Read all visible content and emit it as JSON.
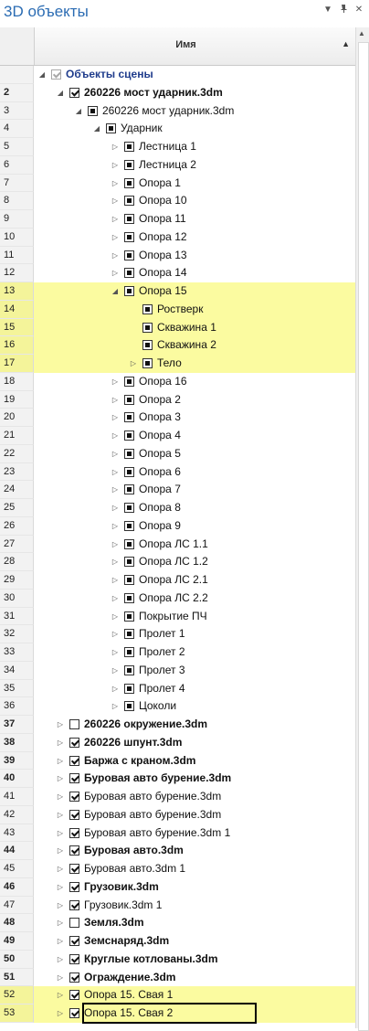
{
  "panel": {
    "title": "3D объекты",
    "dropdown_icon": "chevron-down-icon",
    "pin_icon": "pin-icon",
    "close_icon": "close-icon"
  },
  "grid": {
    "column_name": "Имя",
    "sort_icon": "sort-asc-icon"
  },
  "colors": {
    "highlight": "#fbfba0",
    "title": "#2b6cb3"
  },
  "rows": [
    {
      "num": "",
      "label": "Объекты сцены",
      "level": 0,
      "expander": "expanded",
      "check": "grey",
      "root": true
    },
    {
      "num": "2",
      "label": "260226 мост ударник.3dm",
      "level": 1,
      "expander": "expanded",
      "check": "check",
      "bold": true,
      "numBold": true
    },
    {
      "num": "3",
      "label": "260226 мост ударник.3dm",
      "level": 2,
      "expander": "expanded",
      "check": "part"
    },
    {
      "num": "4",
      "label": "Ударник",
      "level": 3,
      "expander": "expanded",
      "check": "part"
    },
    {
      "num": "5",
      "label": "Лестница 1",
      "level": 4,
      "expander": "collapsed",
      "check": "part"
    },
    {
      "num": "6",
      "label": "Лестница 2",
      "level": 4,
      "expander": "collapsed",
      "check": "part"
    },
    {
      "num": "7",
      "label": "Опора 1",
      "level": 4,
      "expander": "collapsed",
      "check": "part"
    },
    {
      "num": "8",
      "label": "Опора 10",
      "level": 4,
      "expander": "collapsed",
      "check": "part"
    },
    {
      "num": "9",
      "label": "Опора 11",
      "level": 4,
      "expander": "collapsed",
      "check": "part"
    },
    {
      "num": "10",
      "label": "Опора 12",
      "level": 4,
      "expander": "collapsed",
      "check": "part"
    },
    {
      "num": "11",
      "label": "Опора 13",
      "level": 4,
      "expander": "collapsed",
      "check": "part"
    },
    {
      "num": "12",
      "label": "Опора 14",
      "level": 4,
      "expander": "collapsed",
      "check": "part"
    },
    {
      "num": "13",
      "label": "Опора 15",
      "level": 4,
      "expander": "expanded",
      "check": "part",
      "hl": true
    },
    {
      "num": "14",
      "label": "Ростверк",
      "level": 5,
      "expander": "none",
      "check": "part",
      "hl": true
    },
    {
      "num": "15",
      "label": "Скважина 1",
      "level": 5,
      "expander": "none",
      "check": "part",
      "hl": true
    },
    {
      "num": "16",
      "label": "Скважина 2",
      "level": 5,
      "expander": "none",
      "check": "part",
      "hl": true
    },
    {
      "num": "17",
      "label": "Тело",
      "level": 5,
      "expander": "collapsed",
      "check": "part",
      "hl": true
    },
    {
      "num": "18",
      "label": "Опора 16",
      "level": 4,
      "expander": "collapsed",
      "check": "part"
    },
    {
      "num": "19",
      "label": "Опора 2",
      "level": 4,
      "expander": "collapsed",
      "check": "part"
    },
    {
      "num": "20",
      "label": "Опора 3",
      "level": 4,
      "expander": "collapsed",
      "check": "part"
    },
    {
      "num": "21",
      "label": "Опора 4",
      "level": 4,
      "expander": "collapsed",
      "check": "part"
    },
    {
      "num": "22",
      "label": "Опора 5",
      "level": 4,
      "expander": "collapsed",
      "check": "part"
    },
    {
      "num": "23",
      "label": "Опора 6",
      "level": 4,
      "expander": "collapsed",
      "check": "part"
    },
    {
      "num": "24",
      "label": "Опора 7",
      "level": 4,
      "expander": "collapsed",
      "check": "part"
    },
    {
      "num": "25",
      "label": "Опора 8",
      "level": 4,
      "expander": "collapsed",
      "check": "part"
    },
    {
      "num": "26",
      "label": "Опора 9",
      "level": 4,
      "expander": "collapsed",
      "check": "part"
    },
    {
      "num": "27",
      "label": "Опора ЛС 1.1",
      "level": 4,
      "expander": "collapsed",
      "check": "part"
    },
    {
      "num": "28",
      "label": "Опора ЛС 1.2",
      "level": 4,
      "expander": "collapsed",
      "check": "part"
    },
    {
      "num": "29",
      "label": "Опора ЛС 2.1",
      "level": 4,
      "expander": "collapsed",
      "check": "part"
    },
    {
      "num": "30",
      "label": "Опора ЛС 2.2",
      "level": 4,
      "expander": "collapsed",
      "check": "part"
    },
    {
      "num": "31",
      "label": "Покрытие ПЧ",
      "level": 4,
      "expander": "collapsed",
      "check": "part"
    },
    {
      "num": "32",
      "label": "Пролет 1",
      "level": 4,
      "expander": "collapsed",
      "check": "part"
    },
    {
      "num": "33",
      "label": "Пролет 2",
      "level": 4,
      "expander": "collapsed",
      "check": "part"
    },
    {
      "num": "34",
      "label": "Пролет 3",
      "level": 4,
      "expander": "collapsed",
      "check": "part"
    },
    {
      "num": "35",
      "label": "Пролет 4",
      "level": 4,
      "expander": "collapsed",
      "check": "part"
    },
    {
      "num": "36",
      "label": "Цоколи",
      "level": 4,
      "expander": "collapsed",
      "check": "part"
    },
    {
      "num": "37",
      "label": "260226 окружение.3dm",
      "level": 1,
      "expander": "collapsed",
      "check": "none",
      "bold": true,
      "numBold": true
    },
    {
      "num": "38",
      "label": "260226 шпунт.3dm",
      "level": 1,
      "expander": "collapsed",
      "check": "check",
      "bold": true,
      "numBold": true
    },
    {
      "num": "39",
      "label": "Баржа с краном.3dm",
      "level": 1,
      "expander": "collapsed",
      "check": "check",
      "bold": true,
      "numBold": true
    },
    {
      "num": "40",
      "label": "Буровая авто бурение.3dm",
      "level": 1,
      "expander": "collapsed",
      "check": "check",
      "bold": true,
      "numBold": true
    },
    {
      "num": "41",
      "label": "Буровая авто бурение.3dm",
      "level": 1,
      "expander": "collapsed",
      "check": "check"
    },
    {
      "num": "42",
      "label": "Буровая авто бурение.3dm",
      "level": 1,
      "expander": "collapsed",
      "check": "check"
    },
    {
      "num": "43",
      "label": "Буровая авто бурение.3dm 1",
      "level": 1,
      "expander": "collapsed",
      "check": "check"
    },
    {
      "num": "44",
      "label": "Буровая авто.3dm",
      "level": 1,
      "expander": "collapsed",
      "check": "check",
      "bold": true,
      "numBold": true
    },
    {
      "num": "45",
      "label": "Буровая авто.3dm 1",
      "level": 1,
      "expander": "collapsed",
      "check": "check"
    },
    {
      "num": "46",
      "label": "Грузовик.3dm",
      "level": 1,
      "expander": "collapsed",
      "check": "check",
      "bold": true,
      "numBold": true
    },
    {
      "num": "47",
      "label": "Грузовик.3dm 1",
      "level": 1,
      "expander": "collapsed",
      "check": "check"
    },
    {
      "num": "48",
      "label": "Земля.3dm",
      "level": 1,
      "expander": "collapsed",
      "check": "none",
      "bold": true,
      "numBold": true
    },
    {
      "num": "49",
      "label": "Земснаряд.3dm",
      "level": 1,
      "expander": "collapsed",
      "check": "check",
      "bold": true,
      "numBold": true
    },
    {
      "num": "50",
      "label": "Круглые котлованы.3dm",
      "level": 1,
      "expander": "collapsed",
      "check": "check",
      "bold": true,
      "numBold": true
    },
    {
      "num": "51",
      "label": "Ограждение.3dm",
      "level": 1,
      "expander": "collapsed",
      "check": "check",
      "bold": true,
      "numBold": true
    },
    {
      "num": "52",
      "label": "Опора 15. Свая 1",
      "level": 1,
      "expander": "collapsed",
      "check": "check",
      "hl": true
    },
    {
      "num": "53",
      "label": "Опора 15. Свая 2",
      "level": 1,
      "expander": "collapsed",
      "check": "check",
      "hl": true,
      "selected": true
    }
  ]
}
